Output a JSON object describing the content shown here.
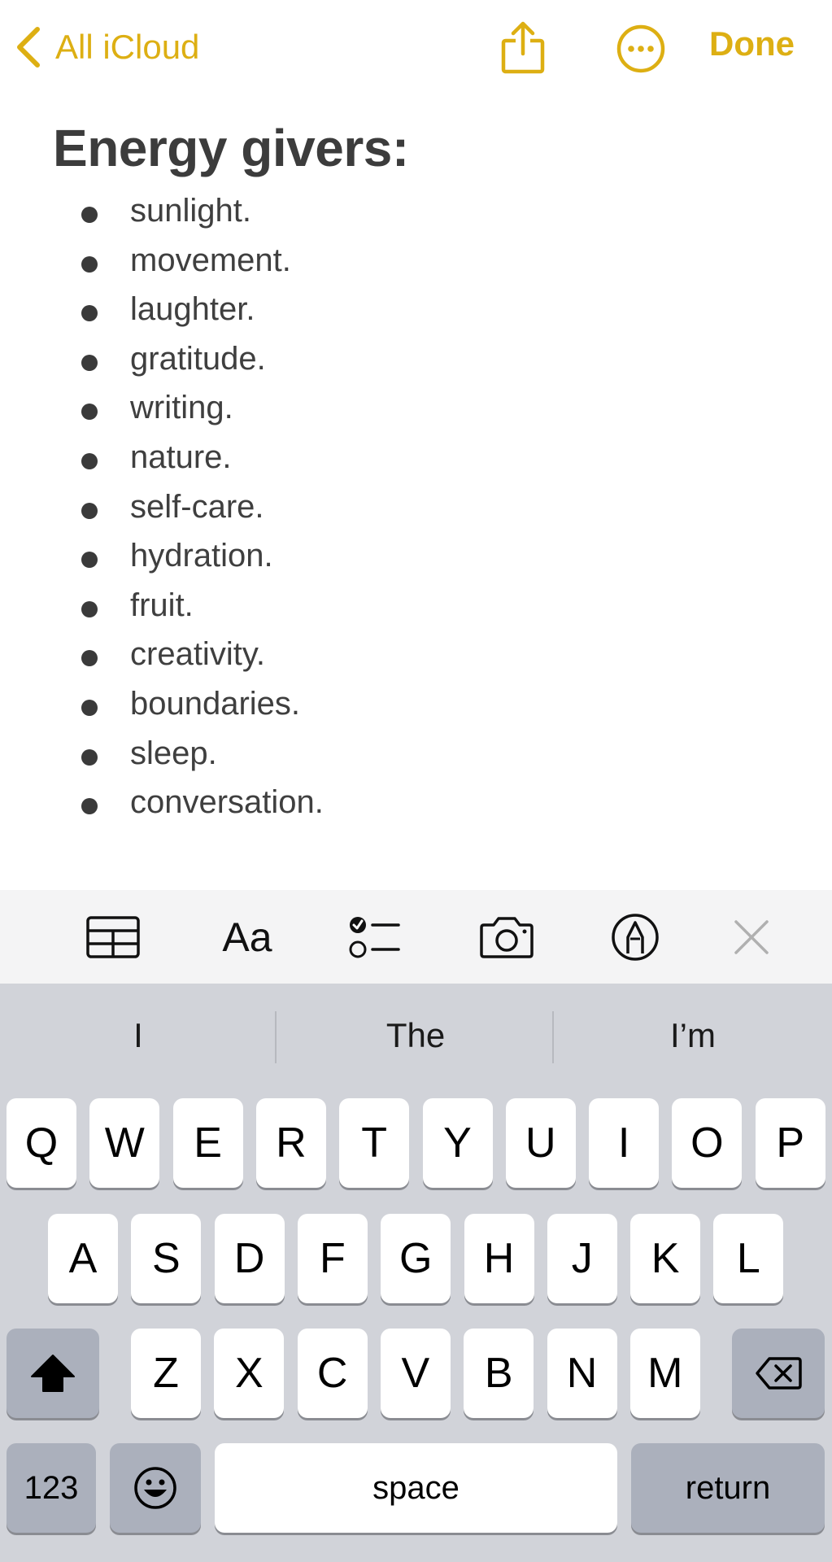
{
  "nav": {
    "back_label": "All iCloud",
    "done_label": "Done",
    "accent_color": "#DDAF13"
  },
  "note": {
    "title": "Energy givers:",
    "items": [
      "sunlight.",
      "movement.",
      "laughter.",
      "gratitude.",
      "writing.",
      "nature.",
      "self-care.",
      "hydration.",
      "fruit.",
      "creativity.",
      "boundaries.",
      "sleep.",
      "conversation."
    ]
  },
  "toolbar": {
    "format_label": "Aa",
    "icons": [
      "table-icon",
      "format-icon",
      "checklist-icon",
      "camera-icon",
      "markup-icon",
      "close-icon"
    ]
  },
  "keyboard": {
    "suggestions": [
      "I",
      "The",
      "I’m"
    ],
    "row1": [
      "Q",
      "W",
      "E",
      "R",
      "T",
      "Y",
      "U",
      "I",
      "O",
      "P"
    ],
    "row2": [
      "A",
      "S",
      "D",
      "F",
      "G",
      "H",
      "J",
      "K",
      "L"
    ],
    "row3": [
      "Z",
      "X",
      "C",
      "V",
      "B",
      "N",
      "M"
    ],
    "numbers_label": "123",
    "space_label": "space",
    "return_label": "return"
  }
}
